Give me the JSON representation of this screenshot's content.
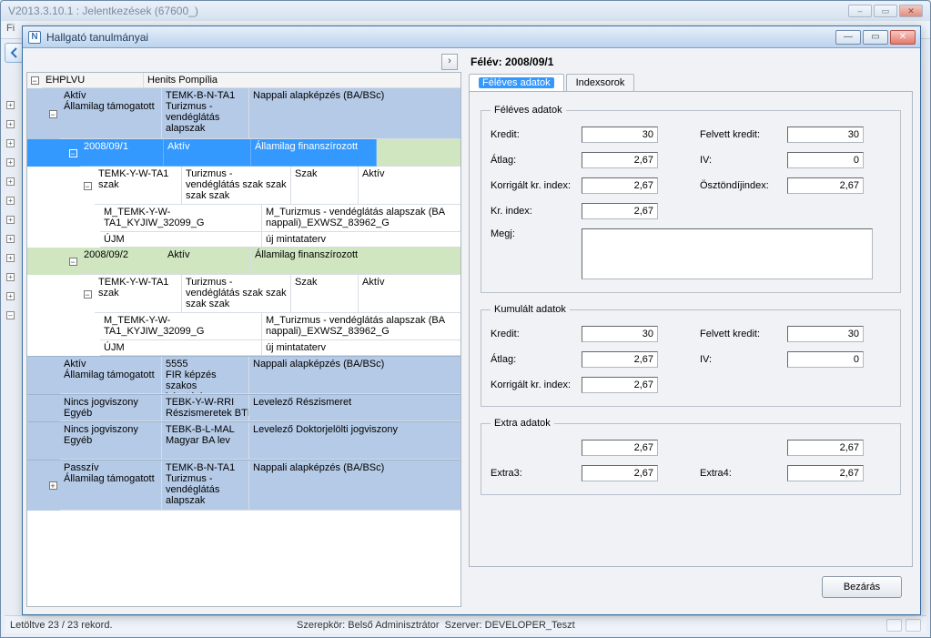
{
  "bgwin": {
    "title": "V2013.3.10.1 : Jelentkezések (67600_)",
    "menu_file": "Fi",
    "status_left": "Letöltve 23 / 23 rekord.",
    "status_role": "Szerepkör: Belső Adminisztrátor",
    "status_server": "Szerver: DEVELOPER_Teszt"
  },
  "dialog": {
    "title": "Hallgató tanulmányai",
    "close_btn": "Bezárás"
  },
  "tree": {
    "root": {
      "code": "EHPLVU",
      "name": "Henits Pompília"
    },
    "prog1": {
      "status": "Aktív",
      "fund": "Államilag támogatott",
      "code": "TEMK-B-N-TA1",
      "desc": "Turizmus - vendéglátás alapszak",
      "schedtype": "Nappali alapképzés (BA/BSc)"
    },
    "sem1": {
      "sem": "2008/09/1",
      "status": "Aktív",
      "fund": "Államilag finanszírozott"
    },
    "sem1_szak": {
      "code": "TEMK-Y-W-TA1",
      "col1b": "szak",
      "desc": "Turizmus - vendéglátás szak szak szak szak",
      "kind": "Szak",
      "state": "Aktív"
    },
    "sem1_mt": {
      "code": "M_TEMK-Y-W-TA1_KYJIW_32099_G",
      "desc": "M_Turizmus - vendéglátás alapszak (BA nappali)_EXWSZ_83962_G"
    },
    "sem1_ujm": {
      "code": "ÚJM",
      "desc": "új mintataterv"
    },
    "sem2": {
      "sem": "2008/09/2",
      "status": "Aktív",
      "fund": "Államilag finanszírozott"
    },
    "sem2_szak": {
      "code": "TEMK-Y-W-TA1",
      "col1b": "szak",
      "desc": "Turizmus - vendéglátás szak szak szak szak",
      "kind": "Szak",
      "state": "Aktív"
    },
    "sem2_mt": {
      "code": "M_TEMK-Y-W-TA1_KYJIW_32099_G",
      "desc": "M_Turizmus - vendéglátás alapszak (BA nappali)_EXWSZ_83962_G"
    },
    "sem2_ujm": {
      "code": "ÚJM",
      "desc": "új mintataterv"
    },
    "prog2": {
      "status": "Aktív",
      "fund": "Államilag támogatott",
      "code": "5555",
      "desc": "FIR képzés szakos jelentéshez",
      "schedtype": "Nappali alapképzés (BA/BSc)"
    },
    "prog3": {
      "status": "Nincs jogviszony",
      "fund": "Egyéb",
      "code": "TEBK-Y-W-RRI",
      "desc": "Részismeretek BTK",
      "schedtype": "Levelező Részismeret"
    },
    "prog4": {
      "status": "Nincs jogviszony",
      "fund": "Egyéb",
      "code": "TEBK-B-L-MAL",
      "desc": "Magyar BA lev",
      "schedtype": "Levelező Doktorjelölti jogviszony"
    },
    "prog5": {
      "status": "Passzív",
      "fund": "Államilag támogatott",
      "code": "TEMK-B-N-TA1",
      "desc": "Turizmus - vendéglátás alapszak",
      "schedtype": "Nappali alapképzés (BA/BSc)"
    }
  },
  "right": {
    "header": "Félév: 2008/09/1",
    "tab_current": "Féléves adatok",
    "tab_rows": "Indexsorok",
    "group_semester": {
      "legend": "Féléves adatok",
      "kredit_lbl": "Kredit:",
      "kredit_val": "30",
      "felvett_lbl": "Felvett kredit:",
      "felvett_val": "30",
      "atlag_lbl": "Átlag:",
      "atlag_val": "2,67",
      "iv_lbl": "IV:",
      "iv_val": "0",
      "korr_lbl": "Korrigált kr. index:",
      "korr_val": "2,67",
      "oszt_lbl": "Ösztöndíjindex:",
      "oszt_val": "2,67",
      "kri_lbl": "Kr. index:",
      "kri_val": "2,67",
      "megj_lbl": "Megj:",
      "megj_val": ""
    },
    "group_cumul": {
      "legend": "Kumulált adatok",
      "kredit_lbl": "Kredit:",
      "kredit_val": "30",
      "felvett_lbl": "Felvett kredit:",
      "felvett_val": "30",
      "atlag_lbl": "Átlag:",
      "atlag_val": "2,67",
      "iv_lbl": "IV:",
      "iv_val": "0",
      "korr_lbl": "Korrigált kr. index:",
      "korr_val": "2,67"
    },
    "group_extra": {
      "legend": "Extra adatok",
      "e1_val": "2,67",
      "e2_val": "2,67",
      "e3_lbl": "Extra3:",
      "e3_val": "2,67",
      "e4_lbl": "Extra4:",
      "e4_val": "2,67"
    }
  }
}
